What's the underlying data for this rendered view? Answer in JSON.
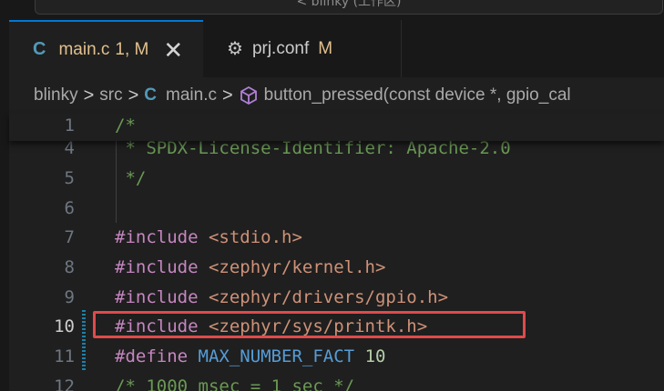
{
  "titlebar": {
    "command_center": "< blinky (工作区)"
  },
  "tabs": [
    {
      "icon": "c-file-icon",
      "icon_glyph": "C",
      "name": "main.c",
      "badge": "1, M",
      "close_glyph": "✕"
    },
    {
      "icon": "gear-icon",
      "icon_glyph": "⚙",
      "name": "prj.conf",
      "badge": "M"
    }
  ],
  "breadcrumb": {
    "items": [
      "blinky",
      "src",
      "main.c",
      "button_pressed(const device *, gpio_cal"
    ],
    "separator": ">",
    "c_glyph": "C"
  },
  "editor": {
    "lines": [
      {
        "num": "1",
        "tokens": [
          [
            "cmt",
            "/*"
          ]
        ]
      },
      {
        "num": "4",
        "tokens": [
          [
            "cmt",
            " * SPDX-License-Identifier: Apache-2.0"
          ]
        ]
      },
      {
        "num": "5",
        "tokens": [
          [
            "cmt",
            " */"
          ]
        ]
      },
      {
        "num": "6",
        "tokens": []
      },
      {
        "num": "7",
        "tokens": [
          [
            "kw",
            "#include"
          ],
          [
            "plain",
            " "
          ],
          [
            "str",
            "<stdio.h>"
          ]
        ]
      },
      {
        "num": "8",
        "tokens": [
          [
            "kw",
            "#include"
          ],
          [
            "plain",
            " "
          ],
          [
            "str",
            "<zephyr/kernel.h>"
          ]
        ]
      },
      {
        "num": "9",
        "tokens": [
          [
            "kw",
            "#include"
          ],
          [
            "plain",
            " "
          ],
          [
            "str",
            "<zephyr/drivers/gpio.h>"
          ]
        ]
      },
      {
        "num": "10",
        "tokens": [
          [
            "kw",
            "#include"
          ],
          [
            "plain",
            " "
          ],
          [
            "str",
            "<zephyr/sys/printk.h>"
          ]
        ]
      },
      {
        "num": "11",
        "tokens": [
          [
            "kw",
            "#define"
          ],
          [
            "plain",
            " "
          ],
          [
            "macro",
            "MAX_NUMBER_FACT"
          ],
          [
            "plain",
            " "
          ],
          [
            "num",
            "10"
          ]
        ]
      },
      {
        "num": "12",
        "tokens": [
          [
            "cmt",
            "/* 1000 msec = 1 sec */"
          ]
        ]
      }
    ],
    "current_line": "10"
  },
  "colors": {
    "background": "#1f1f1f",
    "accent": "#0078d4",
    "comment": "#6a9955",
    "keyword": "#c586c0",
    "string": "#ce9178",
    "macro": "#569cd6",
    "number": "#b5cea8",
    "highlight_box": "#e04a4a"
  }
}
